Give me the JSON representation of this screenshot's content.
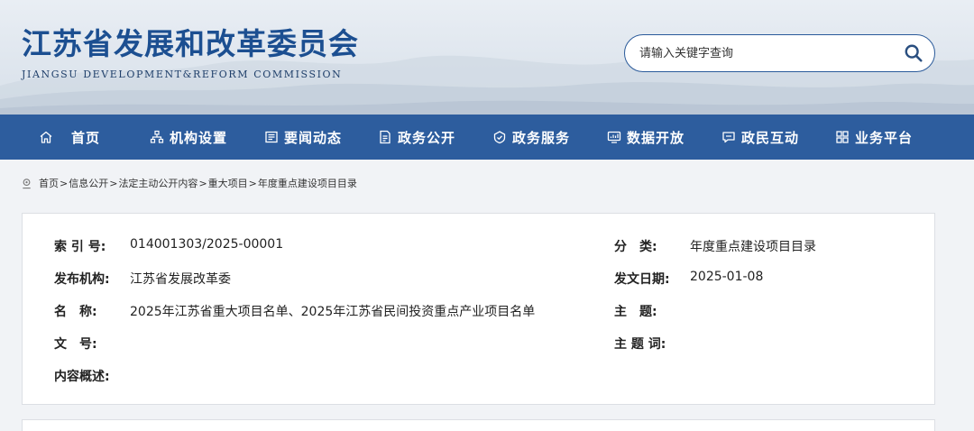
{
  "header": {
    "title": "江苏省发展和改革委员会",
    "subtitle": "JIANGSU DEVELOPMENT&REFORM COMMISSION",
    "search_placeholder": "请输入关键字查询"
  },
  "nav": {
    "items": [
      {
        "label": "首页",
        "icon": "home-icon"
      },
      {
        "label": "机构设置",
        "icon": "org-chart-icon"
      },
      {
        "label": "要闻动态",
        "icon": "news-icon"
      },
      {
        "label": "政务公开",
        "icon": "document-icon"
      },
      {
        "label": "政务服务",
        "icon": "service-icon"
      },
      {
        "label": "数据开放",
        "icon": "data-icon"
      },
      {
        "label": "政民互动",
        "icon": "chat-icon"
      },
      {
        "label": "业务平台",
        "icon": "grid-icon"
      }
    ]
  },
  "breadcrumb": [
    "首页",
    "信息公开",
    "法定主动公开内容",
    "重大项目",
    "年度重点建设项目目录"
  ],
  "info": {
    "index_label": "索 引 号:",
    "index_value": "014001303/2025-00001",
    "category_label": "分　类:",
    "category_value": "年度重点建设项目目录",
    "publisher_label": "发布机构:",
    "publisher_value": "江苏省发展改革委",
    "date_label": "发文日期:",
    "date_value": "2025-01-08",
    "name_label": "名　称:",
    "name_value": "2025年江苏省重大项目名单、2025年江苏省民间投资重点产业项目名单",
    "subject_label": "主　题:",
    "subject_value": "",
    "docno_label": "文　号:",
    "docno_value": "",
    "keywords_label": "主 题 词:",
    "keywords_value": "",
    "summary_label": "内容概述:",
    "summary_value": ""
  },
  "colors": {
    "brand": "#1c4f91",
    "nav_bg": "#2d5d9e"
  }
}
